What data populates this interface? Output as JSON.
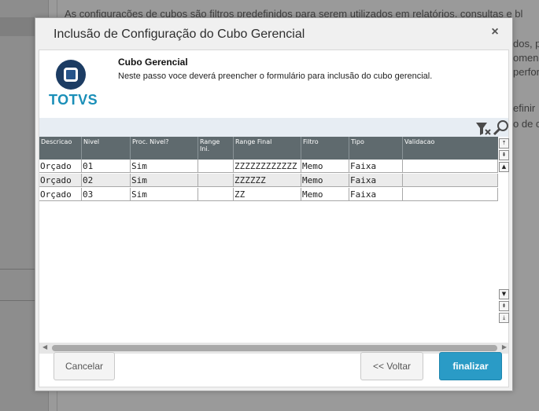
{
  "background": {
    "line1": "As configurações de cubos são filtros predefinidos para serem utilizados em relatórios, consultas e bl",
    "line2": "dos, p",
    "line3": "omen",
    "line4": "perfor",
    "line5": "efinir",
    "line6": "o de c"
  },
  "modal": {
    "title": "Inclusão de Configuração do Cubo Gerencial",
    "close": "×"
  },
  "header": {
    "logo_text": "TOTVS",
    "title": "Cubo Gerencial",
    "description": "Neste passo voce deverá preencher o formulário para inclusão do cubo gerencial."
  },
  "grid": {
    "columns": [
      "Descricao",
      "Nivel",
      "Proc. Nivel?",
      "Range Ini.",
      "Range Final",
      "Filtro",
      "Tipo",
      "Validacao"
    ],
    "rows": [
      [
        "Orçado",
        "01",
        "Sim",
        "",
        "ZZZZZZZZZZZZ",
        "Memo",
        "Faixa",
        ""
      ],
      [
        "Orçado",
        "02",
        "Sim",
        "",
        "ZZZZZZ",
        "Memo",
        "Faixa",
        ""
      ],
      [
        "Orçado",
        "03",
        "Sim",
        "",
        "ZZ",
        "Memo",
        "Faixa",
        ""
      ]
    ]
  },
  "scroll": {
    "top": "⤒",
    "page_up": "⇞",
    "up": "▲",
    "down": "▼",
    "page_down": "⇟",
    "bottom": "⤓",
    "left": "◀",
    "right": "▶"
  },
  "buttons": {
    "cancel": "Cancelar",
    "back": "<< Voltar",
    "finish": "finalizar"
  },
  "colors": {
    "accent": "#2a9bc6",
    "header_bg": "#5f6a6e",
    "logo_blue": "#1a8fb8"
  }
}
